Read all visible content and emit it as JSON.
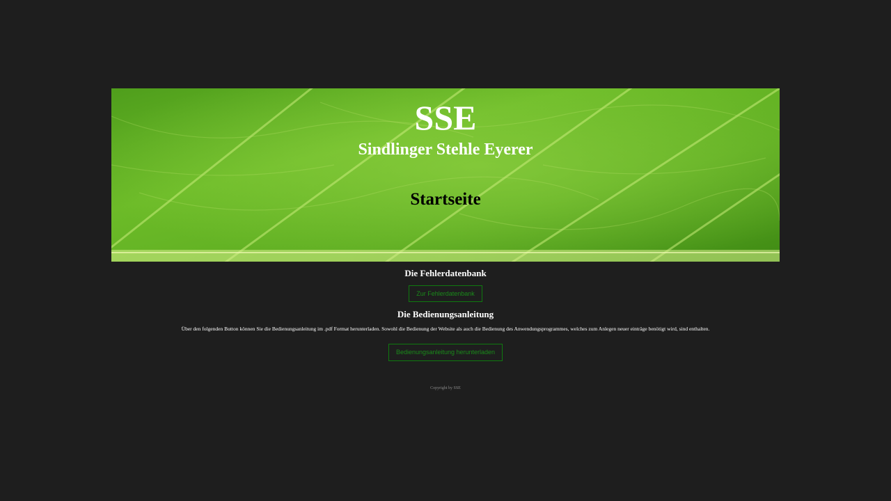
{
  "banner": {
    "title": "SSE",
    "subtitle": "Sindlinger Stehle Eyerer",
    "page_title": "Startseite"
  },
  "fehlerdatenbank": {
    "heading": "Die Fehlerdatenbank",
    "button_label": "Zur Fehlerdatenbank"
  },
  "bedienungsanleitung": {
    "heading": "Die Bedienungsanleitung",
    "text": "Über den folgenden Button können Sie die Bedienungsanleitung im .pdf Format herunterladen. Sowohl die Bedienung der Website als auch die Bedienung des Anwendungsprogrammes, welches zum Anlegen neuer einträge benötigt wird, sind enthalten.",
    "button_label": "Bedienungsanleitung herunterladen"
  },
  "footer": {
    "copyright": "Copyright by SSE"
  },
  "colors": {
    "background": "#1e1e1e",
    "button_border": "#0f7a0f",
    "button_text": "#1a8a1a"
  }
}
